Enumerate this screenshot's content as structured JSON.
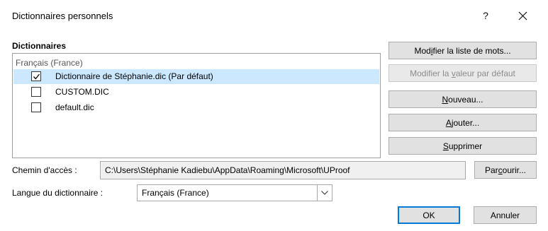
{
  "window": {
    "title": "Dictionnaires personnels",
    "help_label": "?",
    "close_icon": "close-icon"
  },
  "dictionaries": {
    "section_label": "Dictionnaires",
    "group_label": "Français (France)",
    "items": [
      {
        "label": "Dictionnaire de Stéphanie.dic (Par défaut)",
        "checked": true,
        "selected": true
      },
      {
        "label": "CUSTOM.DIC",
        "checked": false,
        "selected": false
      },
      {
        "label": "default.dic",
        "checked": false,
        "selected": false
      }
    ]
  },
  "buttons": {
    "edit_words": {
      "before": "Mod",
      "key": "i",
      "after": "fier la liste de mots..."
    },
    "change_default": {
      "before": "Modifier la ",
      "key": "v",
      "after": "aleur par défaut",
      "disabled": true
    },
    "new": {
      "before": "",
      "key": "N",
      "after": "ouveau..."
    },
    "add": {
      "before": "",
      "key": "A",
      "after": "jouter..."
    },
    "remove": {
      "before": "",
      "key": "S",
      "after": "upprimer"
    },
    "browse": {
      "before": "Par",
      "key": "c",
      "after": "ourir..."
    },
    "ok": "OK",
    "cancel": "Annuler"
  },
  "path": {
    "label": "Chemin d'accès :",
    "value": "C:\\Users\\Stéphanie Kadiebu\\AppData\\Roaming\\Microsoft\\UProof"
  },
  "language": {
    "label_before": "Lan",
    "label_key": "g",
    "label_after": "ue du dictionnaire :",
    "selected": "Français (France)"
  },
  "colors": {
    "selection": "#cce8ff",
    "default_button_border": "#0078d7"
  }
}
